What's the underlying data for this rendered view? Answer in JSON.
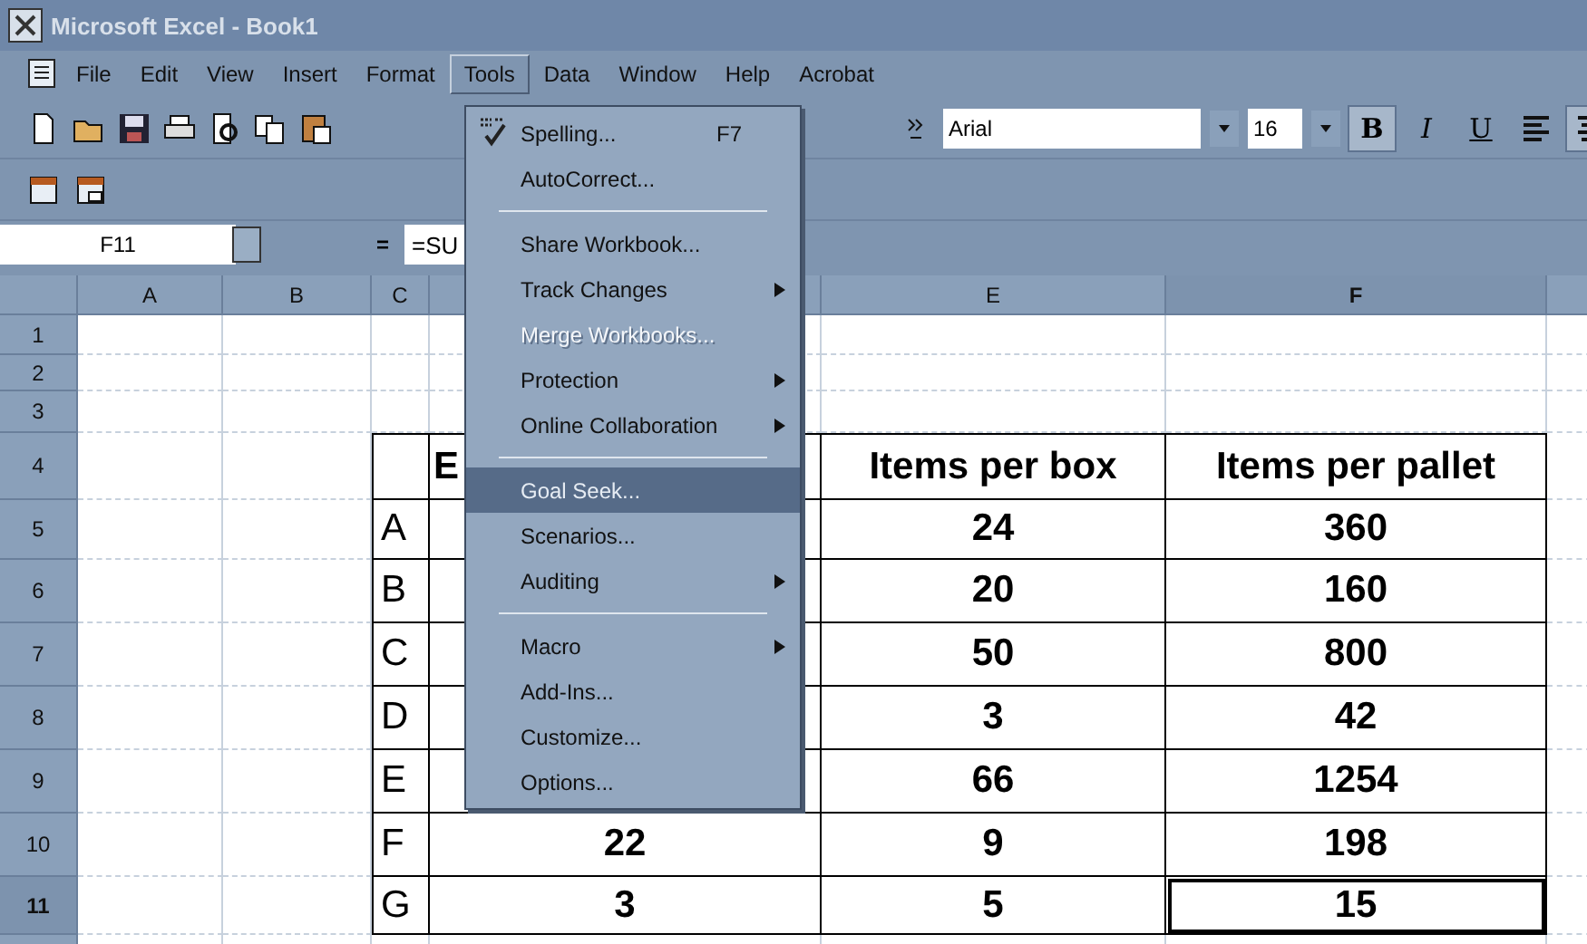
{
  "window": {
    "title": "Microsoft Excel - Book1"
  },
  "menubar": [
    {
      "label": "File",
      "selected": false
    },
    {
      "label": "Edit",
      "selected": false
    },
    {
      "label": "View",
      "selected": false
    },
    {
      "label": "Insert",
      "selected": false
    },
    {
      "label": "Format",
      "selected": false
    },
    {
      "label": "Tools",
      "selected": true
    },
    {
      "label": "Data",
      "selected": false
    },
    {
      "label": "Window",
      "selected": false
    },
    {
      "label": "Help",
      "selected": false
    },
    {
      "label": "Acrobat",
      "selected": false
    }
  ],
  "formatting": {
    "font": "Arial",
    "size": "16",
    "buttons": [
      {
        "kind": "bold",
        "label": "B",
        "pressed": true
      },
      {
        "kind": "italic",
        "label": "I",
        "pressed": false
      },
      {
        "kind": "underline",
        "label": "U",
        "pressed": false
      },
      {
        "kind": "align-left",
        "pressed": false
      },
      {
        "kind": "align-center",
        "pressed": true
      }
    ]
  },
  "formula_bar": {
    "name_box": "F11",
    "equals": "=",
    "formula": "=SU"
  },
  "tools_menu": [
    {
      "kind": "item",
      "label": "Spelling...",
      "shortcut": "F7",
      "submenu": false,
      "disabled": false,
      "selected": false
    },
    {
      "kind": "item",
      "label": "AutoCorrect...",
      "submenu": false,
      "disabled": false,
      "selected": false
    },
    {
      "kind": "separator"
    },
    {
      "kind": "item",
      "label": "Share Workbook...",
      "submenu": false,
      "disabled": false,
      "selected": false
    },
    {
      "kind": "item",
      "label": "Track Changes",
      "submenu": true,
      "disabled": false,
      "selected": false
    },
    {
      "kind": "item",
      "label": "Merge Workbooks...",
      "submenu": false,
      "disabled": true,
      "selected": false
    },
    {
      "kind": "item",
      "label": "Protection",
      "submenu": true,
      "disabled": false,
      "selected": false
    },
    {
      "kind": "item",
      "label": "Online Collaboration",
      "submenu": true,
      "disabled": false,
      "selected": false
    },
    {
      "kind": "separator"
    },
    {
      "kind": "item",
      "label": "Goal Seek...",
      "submenu": false,
      "disabled": false,
      "selected": true
    },
    {
      "kind": "item",
      "label": "Scenarios...",
      "submenu": false,
      "disabled": false,
      "selected": false
    },
    {
      "kind": "item",
      "label": "Auditing",
      "submenu": true,
      "disabled": false,
      "selected": false
    },
    {
      "kind": "separator"
    },
    {
      "kind": "item",
      "label": "Macro",
      "submenu": true,
      "disabled": false,
      "selected": false
    },
    {
      "kind": "item",
      "label": "Add-Ins...",
      "submenu": false,
      "disabled": false,
      "selected": false
    },
    {
      "kind": "item",
      "label": "Customize...",
      "submenu": false,
      "disabled": false,
      "selected": false
    },
    {
      "kind": "item",
      "label": "Options...",
      "submenu": false,
      "disabled": false,
      "selected": false
    }
  ],
  "sheet": {
    "columns": [
      {
        "label": "A",
        "selected": false
      },
      {
        "label": "B",
        "selected": false
      },
      {
        "label": "C",
        "selected": false
      },
      {
        "selected": false
      },
      {
        "label": "E",
        "selected": false
      },
      {
        "label": "F",
        "selected": true
      },
      {
        "selected": false
      }
    ],
    "rows": [
      {
        "label": "1",
        "selected": false
      },
      {
        "label": "2",
        "selected": false
      },
      {
        "label": "3",
        "selected": false
      },
      {
        "label": "4",
        "selected": false,
        "cells": {
          "column_d": "E",
          "column_e": "Items per box",
          "column_f": "Items per pallet"
        }
      },
      {
        "label": "5",
        "selected": false,
        "cells": {
          "column_c": "A",
          "column_e": "24",
          "column_f": "360"
        }
      },
      {
        "label": "6",
        "selected": false,
        "cells": {
          "column_c": "B",
          "column_e": "20",
          "column_f": "160"
        }
      },
      {
        "label": "7",
        "selected": false,
        "cells": {
          "column_c": "C",
          "column_e": "50",
          "column_f": "800"
        }
      },
      {
        "label": "8",
        "selected": false,
        "cells": {
          "column_c": "D",
          "column_e": "3",
          "column_f": "42"
        }
      },
      {
        "label": "9",
        "selected": false,
        "cells": {
          "column_c": "E",
          "column_e": "66",
          "column_f": "1254"
        }
      },
      {
        "label": "10",
        "selected": false,
        "cells": {
          "column_c": "F",
          "column_d": "22",
          "column_e": "9",
          "column_f": "198"
        }
      },
      {
        "label": "11",
        "selected": true,
        "cells": {
          "column_c": "G",
          "column_d": "3",
          "column_e": "5",
          "column_f": "15"
        }
      }
    ]
  }
}
